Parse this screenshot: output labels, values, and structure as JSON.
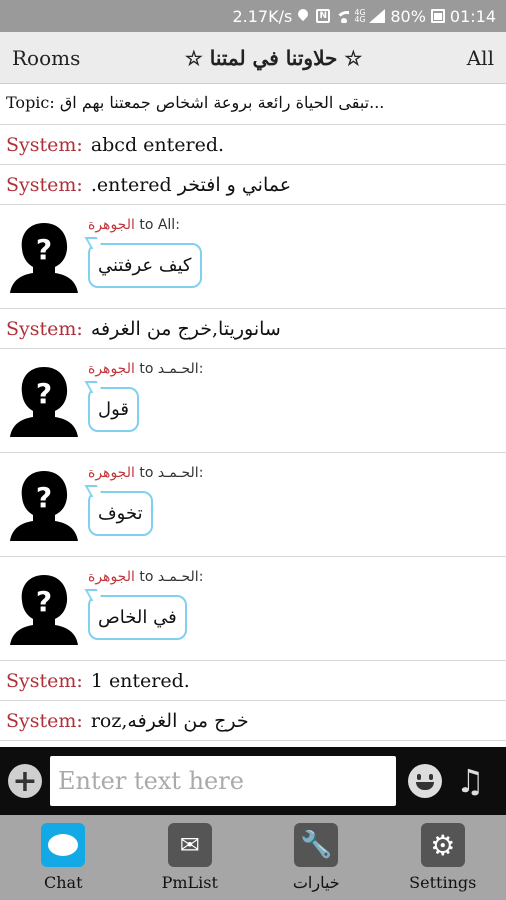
{
  "status_bar": {
    "speed": "2.17K/s",
    "battery": "80%",
    "time": "01:14",
    "net_top": "4G",
    "net_bottom": "4G"
  },
  "header": {
    "left": "Rooms",
    "title": "☆ حلاوتنا في لمتنا ☆",
    "right": "All"
  },
  "topic": {
    "label": "Topic:",
    "text": "تبقى الحياة رائعة بروعة اشخاص جمعتنا بهم اق..."
  },
  "system_label": "System:",
  "messages": [
    {
      "kind": "system",
      "text": "abcd entered."
    },
    {
      "kind": "system",
      "text": ".entered عماني و افتخر"
    },
    {
      "kind": "chat",
      "from": "الجوهرة",
      "to_label": "to",
      "to": "All:",
      "text": "كيف عرفتني",
      "avatar": "anonymous-avatar-icon"
    },
    {
      "kind": "system",
      "text": "سانوريتا,خرج من الغرفه"
    },
    {
      "kind": "chat",
      "from": "الجوهرة",
      "to_label": "to",
      "to": "الحـمـد:",
      "text": "قول",
      "avatar": "anonymous-avatar-icon"
    },
    {
      "kind": "chat",
      "from": "الجوهرة",
      "to_label": "to",
      "to": "الحـمـد:",
      "text": "تخوف",
      "avatar": "anonymous-avatar-icon"
    },
    {
      "kind": "chat",
      "from": "الجوهرة",
      "to_label": "to",
      "to": "الحـمـد:",
      "text": "في الخاص",
      "avatar": "anonymous-avatar-icon"
    },
    {
      "kind": "system",
      "text": "1 entered."
    },
    {
      "kind": "system",
      "text": "roz,خرج من الغرفه"
    }
  ],
  "input": {
    "placeholder": "Enter text here"
  },
  "tabs": [
    {
      "label": "Chat",
      "icon": "chat-bubble-icon"
    },
    {
      "label": "PmList",
      "icon": "phone-mail-icon"
    },
    {
      "label": "خيارات",
      "icon": "wrench-icon"
    },
    {
      "label": "Settings",
      "icon": "gear-icon"
    }
  ],
  "colors": {
    "system_label": "#b0303a",
    "sender": "#c0383e",
    "bubble_border": "#7fd1ee",
    "chat_tab_accent": "#12a9e6"
  }
}
